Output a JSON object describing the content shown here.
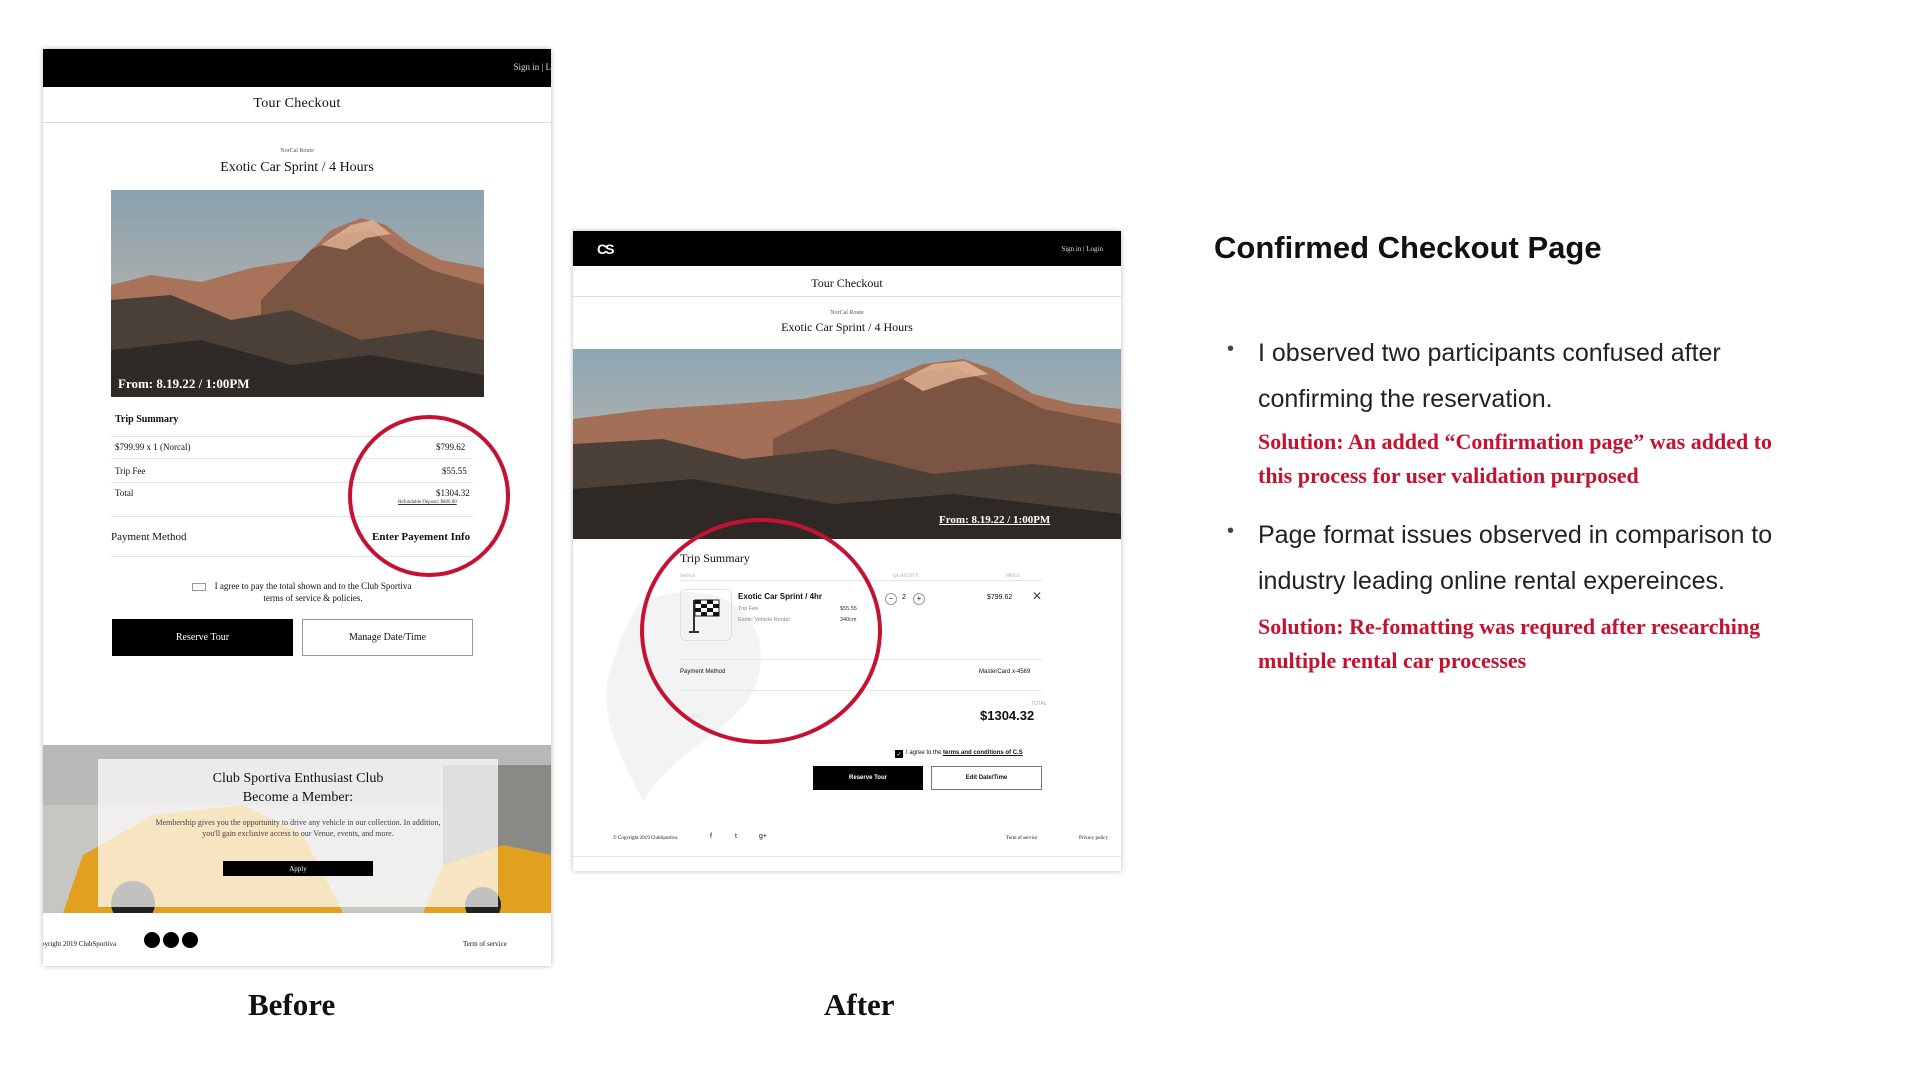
{
  "before": {
    "signin": "Sign in | L",
    "page_title": "Tour Checkout",
    "route": "NorCal Route",
    "trip_name": "Exotic Car Sprint / 4 Hours",
    "hero_caption": "From: 8.19.22 / 1:00PM",
    "summary_title": "Trip Summary",
    "rows": [
      {
        "label": "$799.99 x 1 (Norcal)",
        "value": "$799.62"
      },
      {
        "label": "Trip Fee",
        "value": "$55.55"
      },
      {
        "label": "Total",
        "value": "$1304.32"
      }
    ],
    "deposit_note": "Refundable Deposit: $800.00",
    "payment_label": "Payment Method",
    "payment_link": "Enter Payement Info",
    "agree_text": "I agree to pay the total shown and to the Club Sportiva terms of service  & policies.",
    "reserve_label": "Reserve Tour",
    "manage_label": "Manage Date/Time",
    "club_title": "Club Sportiva Enthusiast Club",
    "club_subtitle": "Become a Member:",
    "club_text": "Membership gives you the opportunity to drive any vehicle in our collection. In addition, you'll gain exclusive access to our Venue, events, and more.",
    "apply_label": "Apply",
    "copyright": "pyright 2019 ClubSportiva",
    "terms": "Term of service"
  },
  "after": {
    "logo": "CS",
    "signin": "Sign in | Login",
    "page_title": "Tour Checkout",
    "route": "NorCal Route",
    "trip_name": "Exotic Car Sprint / 4 Hours",
    "hero_caption": "From: 8.19.22 / 1:00PM",
    "summary_title": "Trip Summary",
    "col_service": "Service",
    "col_quantity": "QUANTITY",
    "col_price": "PRICE",
    "product_name": "Exotic Car Sprint / 4hr",
    "fee_label": "Trip Fee",
    "fee_value": "$55.55",
    "rental_label": "Exotic Vehicle Rental",
    "rental_value": "340cm",
    "minus": "−",
    "quantity": "2",
    "plus": "+",
    "price": "$799.62",
    "close": "✕",
    "payment_label": "Payment Method",
    "card": "MasterCard x-4569",
    "total_label_faint": "TOTAL",
    "total_small": "TOTAL",
    "total": "$1304.32",
    "agree_prefix": "I agree to the ",
    "agree_link": "terms and conditions of C.S",
    "reserve_label": "Reserve Tour",
    "edit_label": "Edit Date/Time",
    "copyright": "© Copyright 2019 ClubSportiva",
    "social": [
      "f",
      "t",
      "g+"
    ],
    "terms": "Term of service",
    "privacy": "Privacy policy"
  },
  "captions": {
    "before": "Before",
    "after": "After"
  },
  "panel": {
    "heading": "Confirmed Checkout Page",
    "bullet1_line1": "I observed two participants confused after",
    "bullet1_line2": "confirming the reservation.",
    "solution1_line1": "Solution: An added “Confirmation page” was added to",
    "solution1_line2": "this process for user validation purposed",
    "bullet2_line1": "Page format issues observed in comparison to",
    "bullet2_line2": "industry leading online rental expereinces.",
    "solution2_line1": "Solution: Re-fomatting was requred after researching",
    "solution2_line2": "multiple rental car processes"
  },
  "colors": {
    "accent_red": "#c41230",
    "black": "#000000"
  },
  "icons": [
    "checkered-flag-icon",
    "close-icon",
    "facebook-icon",
    "twitter-icon",
    "google-plus-icon",
    "bullet-icon"
  ]
}
